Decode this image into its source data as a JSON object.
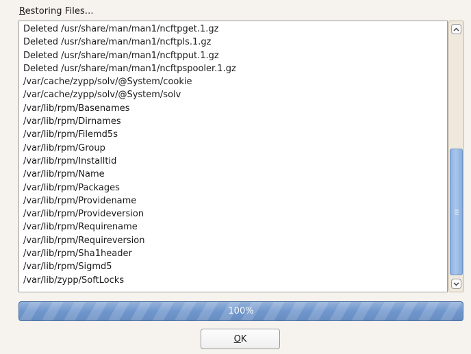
{
  "dialog": {
    "title_mnemonic": "R",
    "title_rest": "estoring Files...",
    "log_lines": [
      "Deleted /usr/share/man/man1/ncftpget.1.gz",
      "Deleted /usr/share/man/man1/ncftpls.1.gz",
      "Deleted /usr/share/man/man1/ncftpput.1.gz",
      "Deleted /usr/share/man/man1/ncftpspooler.1.gz",
      "/var/cache/zypp/solv/@System/cookie",
      "/var/cache/zypp/solv/@System/solv",
      "/var/lib/rpm/Basenames",
      "/var/lib/rpm/Dirnames",
      "/var/lib/rpm/Filemd5s",
      "/var/lib/rpm/Group",
      "/var/lib/rpm/Installtid",
      "/var/lib/rpm/Name",
      "/var/lib/rpm/Packages",
      "/var/lib/rpm/Providename",
      "/var/lib/rpm/Provideversion",
      "/var/lib/rpm/Requirename",
      "/var/lib/rpm/Requireversion",
      "/var/lib/rpm/Sha1header",
      "/var/lib/rpm/Sigmd5",
      "/var/lib/zypp/SoftLocks"
    ],
    "progress_percent": 100,
    "progress_label": "100%",
    "ok_mnemonic": "O",
    "ok_rest": "K"
  },
  "icons": {
    "scroll_up": "chevron-up-icon",
    "scroll_down": "chevron-down-icon"
  },
  "colors": {
    "progress_fill": "#6f96cd",
    "scroll_thumb": "#a9c6ec",
    "background": "#f6f3ef"
  }
}
